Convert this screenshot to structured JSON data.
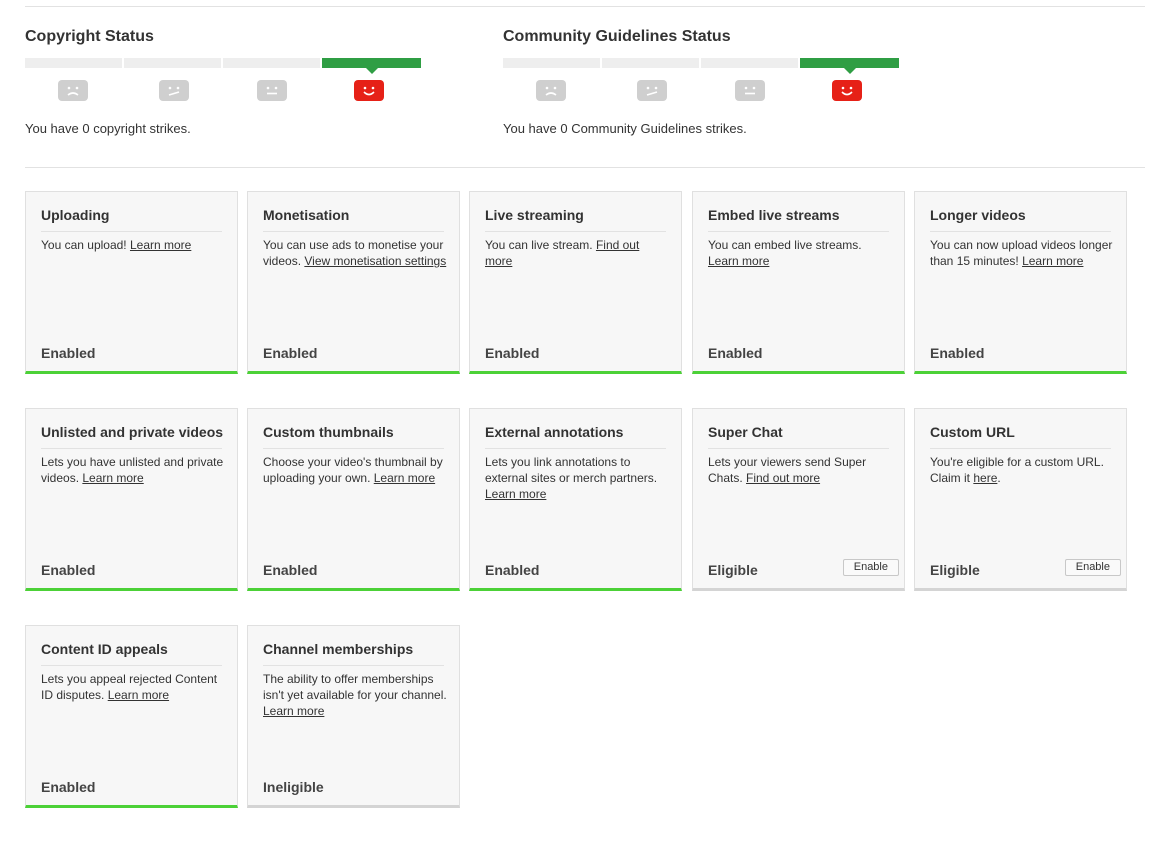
{
  "copyright": {
    "title": "Copyright Status",
    "message": "You have 0 copyright strikes.",
    "active_segment": 4
  },
  "community": {
    "title": "Community Guidelines Status",
    "message": "You have 0 Community Guidelines strikes.",
    "active_segment": 4
  },
  "colors": {
    "enabled": "#4cd137",
    "status_green": "#2f9e44",
    "happy_red": "#e62117",
    "face_gray": "#cfcfcf"
  },
  "cards": [
    {
      "title": "Uploading",
      "desc": "You can upload! ",
      "link": "Learn more",
      "desc_after": "",
      "state": "Enabled"
    },
    {
      "title": "Monetisation",
      "desc": "You can use ads to monetise your videos. ",
      "link": "View monetisation settings",
      "desc_after": "",
      "state": "Enabled"
    },
    {
      "title": "Live streaming",
      "desc": "You can live stream. ",
      "link": "Find out more",
      "desc_after": "",
      "state": "Enabled"
    },
    {
      "title": "Embed live streams",
      "desc": "You can embed live streams. ",
      "link": "Learn more",
      "desc_after": "",
      "state": "Enabled"
    },
    {
      "title": "Longer videos",
      "desc": "You can now upload videos longer than 15 minutes! ",
      "link": "Learn more",
      "desc_after": "",
      "state": "Enabled"
    },
    {
      "title": "Unlisted and private videos",
      "desc": "Lets you have unlisted and private videos. ",
      "link": "Learn more",
      "desc_after": "",
      "state": "Enabled"
    },
    {
      "title": "Custom thumbnails",
      "desc": "Choose your video's thumbnail by uploading your own. ",
      "link": "Learn more",
      "desc_after": "",
      "state": "Enabled"
    },
    {
      "title": "External annotations",
      "desc": "Lets you link annotations to external sites or merch partners. ",
      "link": "Learn more",
      "desc_after": "",
      "state": "Enabled"
    },
    {
      "title": "Super Chat",
      "desc": "Lets your viewers send Super Chats. ",
      "link": "Find out more",
      "desc_after": "",
      "state": "Eligible",
      "button": "Enable"
    },
    {
      "title": "Custom URL",
      "desc": "You're eligible for a custom URL. Claim it ",
      "link": "here",
      "desc_after": ".",
      "state": "Eligible",
      "button": "Enable"
    },
    {
      "title": "Content ID appeals",
      "desc": "Lets you appeal rejected Content ID disputes. ",
      "link": "Learn more",
      "desc_after": "",
      "state": "Enabled"
    },
    {
      "title": "Channel memberships",
      "desc": "The ability to offer memberships isn't yet available for your channel. ",
      "link": "Learn more",
      "desc_after": "",
      "state": "Ineligible"
    }
  ]
}
